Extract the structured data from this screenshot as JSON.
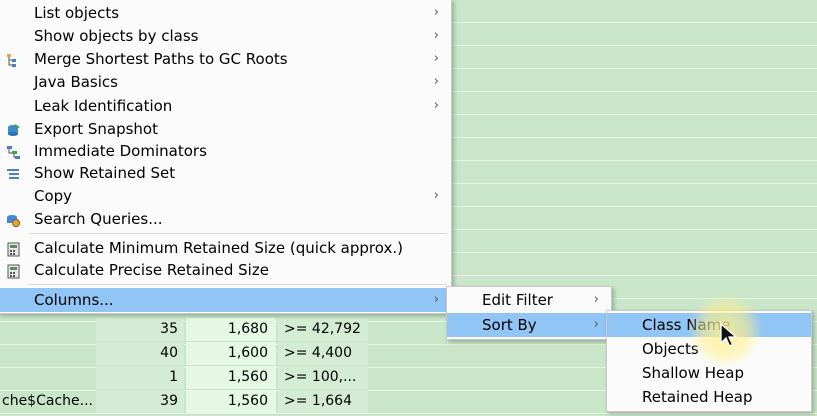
{
  "main_menu": {
    "items": [
      {
        "label": "List objects",
        "submenu": true,
        "icon": ""
      },
      {
        "label": "Show objects by class",
        "submenu": true,
        "icon": ""
      },
      {
        "label": "Merge Shortest Paths to GC Roots",
        "submenu": true,
        "icon": "gc-paths-icon"
      },
      {
        "label": "Java Basics",
        "submenu": true,
        "icon": ""
      },
      {
        "label": "Leak Identification",
        "submenu": true,
        "icon": ""
      },
      {
        "label": "Export Snapshot",
        "submenu": false,
        "icon": "export-snapshot-icon"
      },
      {
        "label": "Immediate Dominators",
        "submenu": false,
        "icon": "dominators-icon"
      },
      {
        "label": "Show Retained Set",
        "submenu": false,
        "icon": "retained-set-icon"
      },
      {
        "label": "Copy",
        "submenu": true,
        "icon": ""
      },
      {
        "label": "Search Queries...",
        "submenu": false,
        "icon": "search-queries-icon"
      },
      {
        "label": "Calculate Minimum Retained Size (quick approx.)",
        "submenu": false,
        "icon": "calculator-icon"
      },
      {
        "label": "Calculate Precise Retained Size",
        "submenu": false,
        "icon": "calculator-icon"
      },
      {
        "label": "Columns...",
        "submenu": true,
        "icon": "",
        "selected": true
      }
    ],
    "arrow_glyph": "›"
  },
  "columns_menu": {
    "items": [
      {
        "label": "Edit Filter",
        "submenu": true
      },
      {
        "label": "Sort By",
        "submenu": true,
        "selected": true
      }
    ]
  },
  "sort_menu": {
    "items": [
      {
        "label": "Class Name",
        "selected": true
      },
      {
        "label": "Objects"
      },
      {
        "label": "Shallow Heap"
      },
      {
        "label": "Retained Heap"
      }
    ]
  },
  "table": {
    "rows": [
      {
        "name": "",
        "objects": "35",
        "shallow": "1,680",
        "retained": ">= 42,792"
      },
      {
        "name": "",
        "objects": "40",
        "shallow": "1,600",
        "retained": ">= 4,400"
      },
      {
        "name": "",
        "objects": "1",
        "shallow": "1,560",
        "retained": ">= 100,..."
      },
      {
        "name": "che$Cache...",
        "objects": "39",
        "shallow": "1,560",
        "retained": ">= 1,664"
      }
    ]
  },
  "colors": {
    "selection": "#91c5f5",
    "table_bg": "#c9e6c9"
  }
}
